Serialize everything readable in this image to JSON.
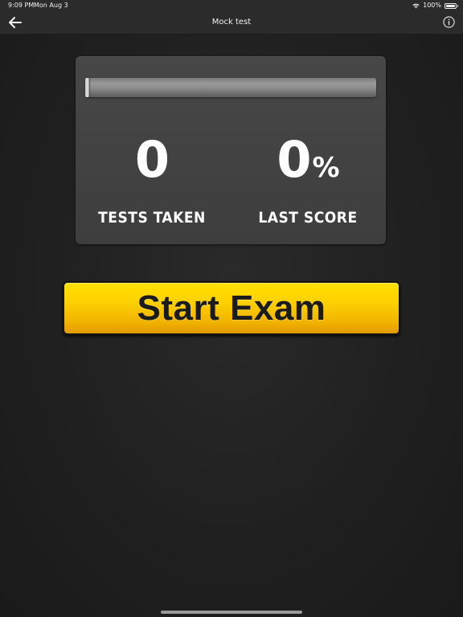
{
  "status_bar": {
    "time": "9:09 PM",
    "date": "Mon Aug 3",
    "battery": "100%",
    "wifi_icon": "wifi-icon",
    "battery_icon": "battery-icon"
  },
  "nav": {
    "title": "Mock test",
    "back_icon": "arrow-left-icon",
    "info_icon": "info-icon"
  },
  "stats": {
    "progress": 0,
    "progress_fill_color": "#e0a800",
    "tests_taken_value": "0",
    "tests_taken_label": "TESTS TAKEN",
    "last_score_value": "0",
    "last_score_unit": "%",
    "last_score_label": "LAST SCORE"
  },
  "start_button": {
    "label": "Start Exam",
    "color": "#fcd000"
  }
}
